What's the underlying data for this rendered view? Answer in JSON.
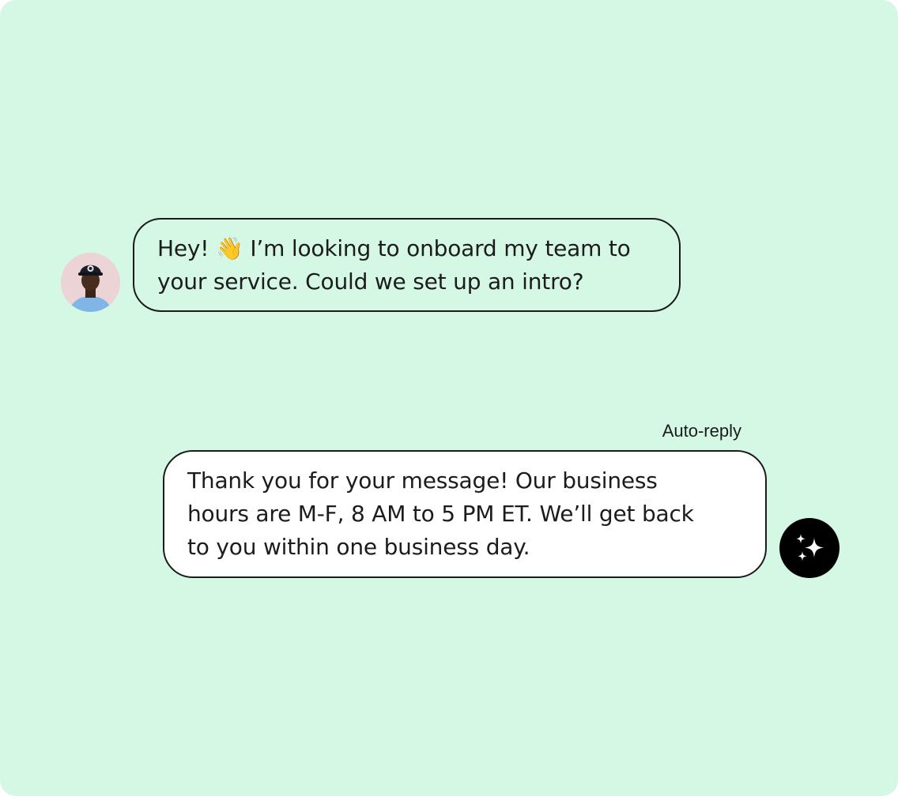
{
  "conversation": {
    "incoming": {
      "avatar": "person-avatar",
      "text_before_emoji": "Hey! ",
      "emoji": "👋",
      "text_after_emoji": " I’m looking to onboard my team to\nyour service. Could we set up an intro?"
    },
    "reply": {
      "label": "Auto-reply",
      "text": "Thank you for your message! Our business\nhours are M-F, 8 AM to 5 PM ET. We’ll get back\nto you within one business day.",
      "icon": "sparkles-icon"
    }
  },
  "colors": {
    "background": "#d5f8e5",
    "bubble_border": "#1b1b1b",
    "reply_bubble": "#ffffff",
    "bot_avatar": "#000000"
  }
}
